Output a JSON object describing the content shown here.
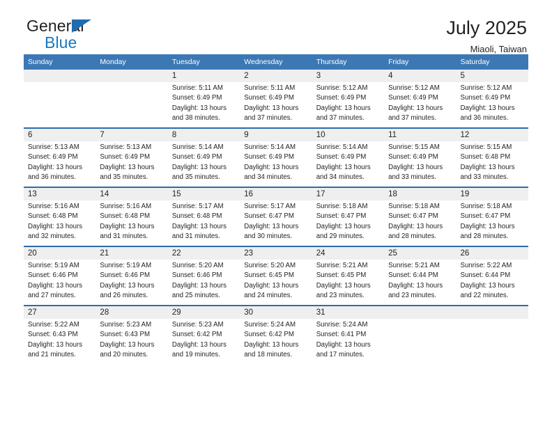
{
  "brand": {
    "name_top": "General",
    "name_bottom": "Blue",
    "triangle_color": "#1f6cb0",
    "blue_color": "#1878be"
  },
  "header": {
    "title": "July 2025",
    "location": "Miaoli, Taiwan"
  },
  "theme": {
    "header_bg": "#3c78b4",
    "row_divider": "#2b6ca8",
    "daynum_bg": "#efefef",
    "text": "#231f20"
  },
  "weekdays": [
    "Sunday",
    "Monday",
    "Tuesday",
    "Wednesday",
    "Thursday",
    "Friday",
    "Saturday"
  ],
  "labels": {
    "sunrise_prefix": "Sunrise:",
    "sunset_prefix": "Sunset:",
    "daylight_prefix": "Daylight:"
  },
  "weeks": [
    [
      {
        "day": "",
        "sunrise": "",
        "sunset": "",
        "daylight": ""
      },
      {
        "day": "",
        "sunrise": "",
        "sunset": "",
        "daylight": ""
      },
      {
        "day": "1",
        "sunrise": "Sunrise: 5:11 AM",
        "sunset": "Sunset: 6:49 PM",
        "daylight": "Daylight: 13 hours and 38 minutes."
      },
      {
        "day": "2",
        "sunrise": "Sunrise: 5:11 AM",
        "sunset": "Sunset: 6:49 PM",
        "daylight": "Daylight: 13 hours and 37 minutes."
      },
      {
        "day": "3",
        "sunrise": "Sunrise: 5:12 AM",
        "sunset": "Sunset: 6:49 PM",
        "daylight": "Daylight: 13 hours and 37 minutes."
      },
      {
        "day": "4",
        "sunrise": "Sunrise: 5:12 AM",
        "sunset": "Sunset: 6:49 PM",
        "daylight": "Daylight: 13 hours and 37 minutes."
      },
      {
        "day": "5",
        "sunrise": "Sunrise: 5:12 AM",
        "sunset": "Sunset: 6:49 PM",
        "daylight": "Daylight: 13 hours and 36 minutes."
      }
    ],
    [
      {
        "day": "6",
        "sunrise": "Sunrise: 5:13 AM",
        "sunset": "Sunset: 6:49 PM",
        "daylight": "Daylight: 13 hours and 36 minutes."
      },
      {
        "day": "7",
        "sunrise": "Sunrise: 5:13 AM",
        "sunset": "Sunset: 6:49 PM",
        "daylight": "Daylight: 13 hours and 35 minutes."
      },
      {
        "day": "8",
        "sunrise": "Sunrise: 5:14 AM",
        "sunset": "Sunset: 6:49 PM",
        "daylight": "Daylight: 13 hours and 35 minutes."
      },
      {
        "day": "9",
        "sunrise": "Sunrise: 5:14 AM",
        "sunset": "Sunset: 6:49 PM",
        "daylight": "Daylight: 13 hours and 34 minutes."
      },
      {
        "day": "10",
        "sunrise": "Sunrise: 5:14 AM",
        "sunset": "Sunset: 6:49 PM",
        "daylight": "Daylight: 13 hours and 34 minutes."
      },
      {
        "day": "11",
        "sunrise": "Sunrise: 5:15 AM",
        "sunset": "Sunset: 6:49 PM",
        "daylight": "Daylight: 13 hours and 33 minutes."
      },
      {
        "day": "12",
        "sunrise": "Sunrise: 5:15 AM",
        "sunset": "Sunset: 6:48 PM",
        "daylight": "Daylight: 13 hours and 33 minutes."
      }
    ],
    [
      {
        "day": "13",
        "sunrise": "Sunrise: 5:16 AM",
        "sunset": "Sunset: 6:48 PM",
        "daylight": "Daylight: 13 hours and 32 minutes."
      },
      {
        "day": "14",
        "sunrise": "Sunrise: 5:16 AM",
        "sunset": "Sunset: 6:48 PM",
        "daylight": "Daylight: 13 hours and 31 minutes."
      },
      {
        "day": "15",
        "sunrise": "Sunrise: 5:17 AM",
        "sunset": "Sunset: 6:48 PM",
        "daylight": "Daylight: 13 hours and 31 minutes."
      },
      {
        "day": "16",
        "sunrise": "Sunrise: 5:17 AM",
        "sunset": "Sunset: 6:47 PM",
        "daylight": "Daylight: 13 hours and 30 minutes."
      },
      {
        "day": "17",
        "sunrise": "Sunrise: 5:18 AM",
        "sunset": "Sunset: 6:47 PM",
        "daylight": "Daylight: 13 hours and 29 minutes."
      },
      {
        "day": "18",
        "sunrise": "Sunrise: 5:18 AM",
        "sunset": "Sunset: 6:47 PM",
        "daylight": "Daylight: 13 hours and 28 minutes."
      },
      {
        "day": "19",
        "sunrise": "Sunrise: 5:18 AM",
        "sunset": "Sunset: 6:47 PM",
        "daylight": "Daylight: 13 hours and 28 minutes."
      }
    ],
    [
      {
        "day": "20",
        "sunrise": "Sunrise: 5:19 AM",
        "sunset": "Sunset: 6:46 PM",
        "daylight": "Daylight: 13 hours and 27 minutes."
      },
      {
        "day": "21",
        "sunrise": "Sunrise: 5:19 AM",
        "sunset": "Sunset: 6:46 PM",
        "daylight": "Daylight: 13 hours and 26 minutes."
      },
      {
        "day": "22",
        "sunrise": "Sunrise: 5:20 AM",
        "sunset": "Sunset: 6:46 PM",
        "daylight": "Daylight: 13 hours and 25 minutes."
      },
      {
        "day": "23",
        "sunrise": "Sunrise: 5:20 AM",
        "sunset": "Sunset: 6:45 PM",
        "daylight": "Daylight: 13 hours and 24 minutes."
      },
      {
        "day": "24",
        "sunrise": "Sunrise: 5:21 AM",
        "sunset": "Sunset: 6:45 PM",
        "daylight": "Daylight: 13 hours and 23 minutes."
      },
      {
        "day": "25",
        "sunrise": "Sunrise: 5:21 AM",
        "sunset": "Sunset: 6:44 PM",
        "daylight": "Daylight: 13 hours and 23 minutes."
      },
      {
        "day": "26",
        "sunrise": "Sunrise: 5:22 AM",
        "sunset": "Sunset: 6:44 PM",
        "daylight": "Daylight: 13 hours and 22 minutes."
      }
    ],
    [
      {
        "day": "27",
        "sunrise": "Sunrise: 5:22 AM",
        "sunset": "Sunset: 6:43 PM",
        "daylight": "Daylight: 13 hours and 21 minutes."
      },
      {
        "day": "28",
        "sunrise": "Sunrise: 5:23 AM",
        "sunset": "Sunset: 6:43 PM",
        "daylight": "Daylight: 13 hours and 20 minutes."
      },
      {
        "day": "29",
        "sunrise": "Sunrise: 5:23 AM",
        "sunset": "Sunset: 6:42 PM",
        "daylight": "Daylight: 13 hours and 19 minutes."
      },
      {
        "day": "30",
        "sunrise": "Sunrise: 5:24 AM",
        "sunset": "Sunset: 6:42 PM",
        "daylight": "Daylight: 13 hours and 18 minutes."
      },
      {
        "day": "31",
        "sunrise": "Sunrise: 5:24 AM",
        "sunset": "Sunset: 6:41 PM",
        "daylight": "Daylight: 13 hours and 17 minutes."
      },
      {
        "day": "",
        "sunrise": "",
        "sunset": "",
        "daylight": ""
      },
      {
        "day": "",
        "sunrise": "",
        "sunset": "",
        "daylight": ""
      }
    ]
  ]
}
